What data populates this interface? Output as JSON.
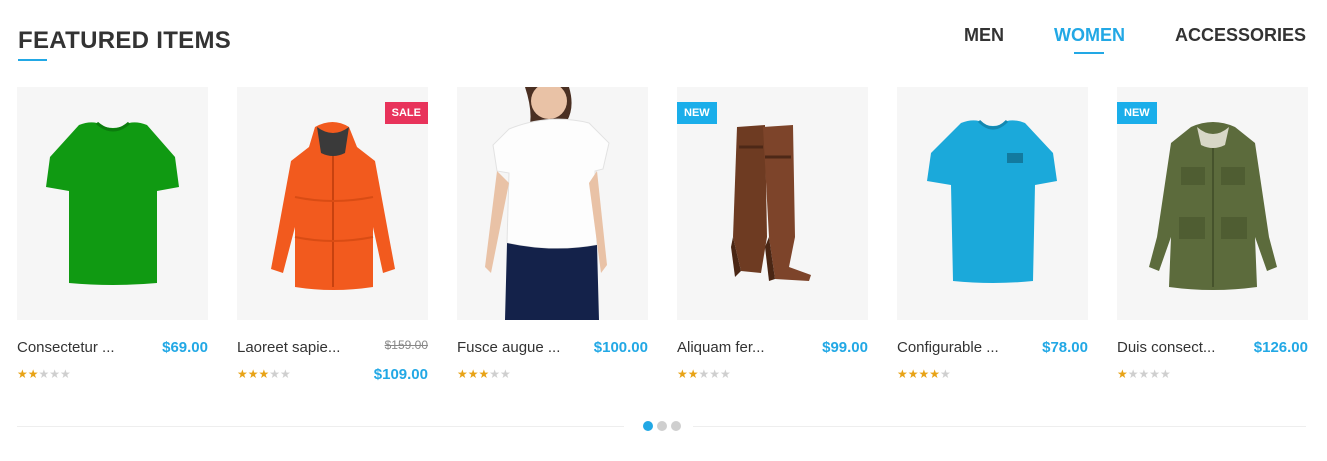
{
  "section": {
    "title": "FEATURED ITEMS"
  },
  "tabs": [
    {
      "label": "MEN",
      "active": false
    },
    {
      "label": "WOMEN",
      "active": true
    },
    {
      "label": "ACCESSORIES",
      "active": false
    }
  ],
  "products": [
    {
      "name": "Consectetur ...",
      "price": "$69.00",
      "old_price": "",
      "badge": "",
      "rating": 2,
      "max_rating": 5,
      "image": "green-tshirt"
    },
    {
      "name": "Laoreet sapie...",
      "price": "$109.00",
      "old_price": "$159.00",
      "badge": "SALE",
      "rating": 3,
      "max_rating": 5,
      "image": "orange-jacket"
    },
    {
      "name": "Fusce augue ...",
      "price": "$100.00",
      "old_price": "",
      "badge": "",
      "rating": 3,
      "max_rating": 5,
      "image": "white-tshirt-model"
    },
    {
      "name": "Aliquam fer...",
      "price": "$99.00",
      "old_price": "",
      "badge": "NEW",
      "rating": 2,
      "max_rating": 5,
      "image": "brown-boots"
    },
    {
      "name": "Configurable ...",
      "price": "$78.00",
      "old_price": "",
      "badge": "",
      "rating": 4,
      "max_rating": 5,
      "image": "blue-tshirt"
    },
    {
      "name": "Duis consect...",
      "price": "$126.00",
      "old_price": "",
      "badge": "NEW",
      "rating": 1,
      "max_rating": 5,
      "image": "olive-jacket"
    }
  ],
  "pager": {
    "count": 3,
    "active_index": 0
  },
  "colors": {
    "accent": "#22a8e5",
    "sale_badge": "#e8335b",
    "new_badge": "#1aaeea",
    "star": "#e8a316"
  }
}
